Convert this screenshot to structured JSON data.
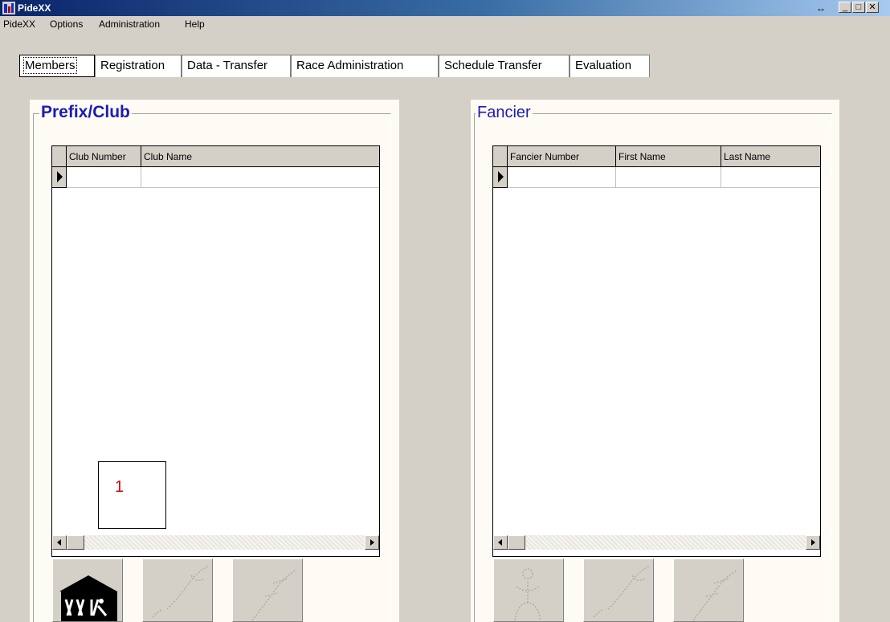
{
  "window": {
    "title": "PideXX",
    "resize_glyph": "↔"
  },
  "menu": [
    "PideXX",
    "Options",
    "Administration",
    "Help"
  ],
  "tabs": [
    "Members",
    "Registration",
    "Data - Transfer",
    "Race Administration",
    "Schedule Transfer",
    "Evaluation"
  ],
  "left_panel": {
    "title": "Prefix/Club",
    "columns": [
      "Club Number",
      "Club Name"
    ]
  },
  "right_panel": {
    "title": "Fancier",
    "columns": [
      "Fancier Number",
      "First Name",
      "Last Name"
    ]
  },
  "annotation": {
    "label": "1"
  },
  "colors": {
    "title_text_left": "#1c1cb4",
    "accent_red": "#e00000"
  }
}
